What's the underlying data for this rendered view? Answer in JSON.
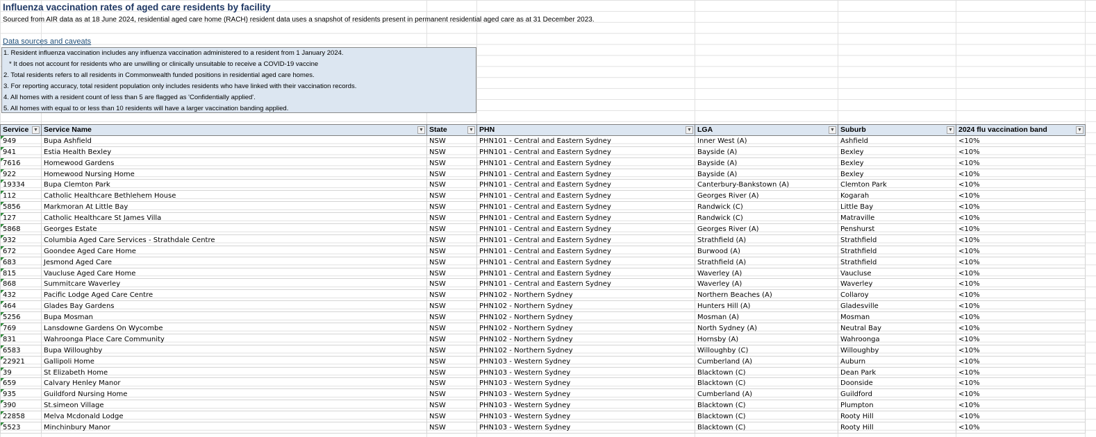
{
  "title": "Influenza vaccination rates of aged care residents by facility",
  "subtitle": "Sourced from AIR data as at 18 June 2024, residential aged care home (RACH) resident data uses a snapshot of residents present in permanent residential aged care as at 31 December 2023.",
  "caveats_link": "Data sources and caveats",
  "caveats": [
    "1. Resident influenza vaccination includes any influenza vaccination administered to a resident from 1 January 2024.",
    "   * It does not account for residents who are unwilling or clinically unsuitable to receive a COVID-19 vaccine",
    "2. Total residents refers to all residents in Commonwealth funded positions in residential aged care homes.",
    "3. For reporting accuracy, total resident population only includes residents who have linked with their vaccination records.",
    "4. All homes with a resident count of less than 5 are flagged as 'Confidentially applied'.",
    "5. All homes with equal to or less than 10 residents will have a larger vaccination banding applied."
  ],
  "filter_icon": "dropdown-arrow-icon",
  "columns": [
    "Service",
    "Service Name",
    "State",
    "PHN",
    "LGA",
    "Suburb",
    "2024 flu vaccination band"
  ],
  "rows": [
    [
      "949",
      "Bupa Ashfield",
      "NSW",
      "PHN101 - Central and Eastern Sydney",
      "Inner West (A)",
      "Ashfield",
      "<10%"
    ],
    [
      "941",
      "Estia Health Bexley",
      "NSW",
      "PHN101 - Central and Eastern Sydney",
      "Bayside (A)",
      "Bexley",
      "<10%"
    ],
    [
      "7616",
      "Homewood Gardens",
      "NSW",
      "PHN101 - Central and Eastern Sydney",
      "Bayside (A)",
      "Bexley",
      "<10%"
    ],
    [
      "922",
      "Homewood Nursing Home",
      "NSW",
      "PHN101 - Central and Eastern Sydney",
      "Bayside (A)",
      "Bexley",
      "<10%"
    ],
    [
      "19334",
      "Bupa Clemton Park",
      "NSW",
      "PHN101 - Central and Eastern Sydney",
      "Canterbury-Bankstown (A)",
      "Clemton Park",
      "<10%"
    ],
    [
      "112",
      "Catholic Healthcare Bethlehem House",
      "NSW",
      "PHN101 - Central and Eastern Sydney",
      "Georges River (A)",
      "Kogarah",
      "<10%"
    ],
    [
      "5856",
      "Markmoran At Little Bay",
      "NSW",
      "PHN101 - Central and Eastern Sydney",
      "Randwick (C)",
      "Little Bay",
      "<10%"
    ],
    [
      "127",
      "Catholic Healthcare St James Villa",
      "NSW",
      "PHN101 - Central and Eastern Sydney",
      "Randwick (C)",
      "Matraville",
      "<10%"
    ],
    [
      "5868",
      "Georges Estate",
      "NSW",
      "PHN101 - Central and Eastern Sydney",
      "Georges River (A)",
      "Penshurst",
      "<10%"
    ],
    [
      "932",
      "Columbia Aged Care Services - Strathdale Centre",
      "NSW",
      "PHN101 - Central and Eastern Sydney",
      "Strathfield (A)",
      "Strathfield",
      "<10%"
    ],
    [
      "672",
      "Goondee Aged Care Home",
      "NSW",
      "PHN101 - Central and Eastern Sydney",
      "Burwood (A)",
      "Strathfield",
      "<10%"
    ],
    [
      "683",
      "Jesmond Aged Care",
      "NSW",
      "PHN101 - Central and Eastern Sydney",
      "Strathfield (A)",
      "Strathfield",
      "<10%"
    ],
    [
      "815",
      "Vaucluse Aged Care Home",
      "NSW",
      "PHN101 - Central and Eastern Sydney",
      "Waverley (A)",
      "Vaucluse",
      "<10%"
    ],
    [
      "868",
      "Summitcare Waverley",
      "NSW",
      "PHN101 - Central and Eastern Sydney",
      "Waverley (A)",
      "Waverley",
      "<10%"
    ],
    [
      "432",
      "Pacific Lodge Aged Care Centre",
      "NSW",
      "PHN102 - Northern Sydney",
      "Northern Beaches (A)",
      "Collaroy",
      "<10%"
    ],
    [
      "464",
      "Glades Bay Gardens",
      "NSW",
      "PHN102 - Northern Sydney",
      "Hunters Hill (A)",
      "Gladesville",
      "<10%"
    ],
    [
      "5256",
      "Bupa Mosman",
      "NSW",
      "PHN102 - Northern Sydney",
      "Mosman (A)",
      "Mosman",
      "<10%"
    ],
    [
      "769",
      "Lansdowne Gardens On Wycombe",
      "NSW",
      "PHN102 - Northern Sydney",
      "North Sydney (A)",
      "Neutral Bay",
      "<10%"
    ],
    [
      "831",
      "Wahroonga Place Care Community",
      "NSW",
      "PHN102 - Northern Sydney",
      "Hornsby (A)",
      "Wahroonga",
      "<10%"
    ],
    [
      "6583",
      "Bupa Willoughby",
      "NSW",
      "PHN102 - Northern Sydney",
      "Willoughby (C)",
      "Willoughby",
      "<10%"
    ],
    [
      "22921",
      "Gallipoli Home",
      "NSW",
      "PHN103 - Western Sydney",
      "Cumberland (A)",
      "Auburn",
      "<10%"
    ],
    [
      "39",
      "St Elizabeth Home",
      "NSW",
      "PHN103 - Western Sydney",
      "Blacktown (C)",
      "Dean Park",
      "<10%"
    ],
    [
      "659",
      "Calvary Henley Manor",
      "NSW",
      "PHN103 - Western Sydney",
      "Blacktown (C)",
      "Doonside",
      "<10%"
    ],
    [
      "935",
      "Guildford Nursing Home",
      "NSW",
      "PHN103 - Western Sydney",
      "Cumberland (A)",
      "Guildford",
      "<10%"
    ],
    [
      "390",
      "St.simeon Village",
      "NSW",
      "PHN103 - Western Sydney",
      "Blacktown (C)",
      "Plumpton",
      "<10%"
    ],
    [
      "22858",
      "Melva Mcdonald Lodge",
      "NSW",
      "PHN103 - Western Sydney",
      "Blacktown (C)",
      "Rooty Hill",
      "<10%"
    ],
    [
      "5523",
      "Minchinbury Manor",
      "NSW",
      "PHN103 - Western Sydney",
      "Blacktown (C)",
      "Rooty Hill",
      "<10%"
    ]
  ]
}
